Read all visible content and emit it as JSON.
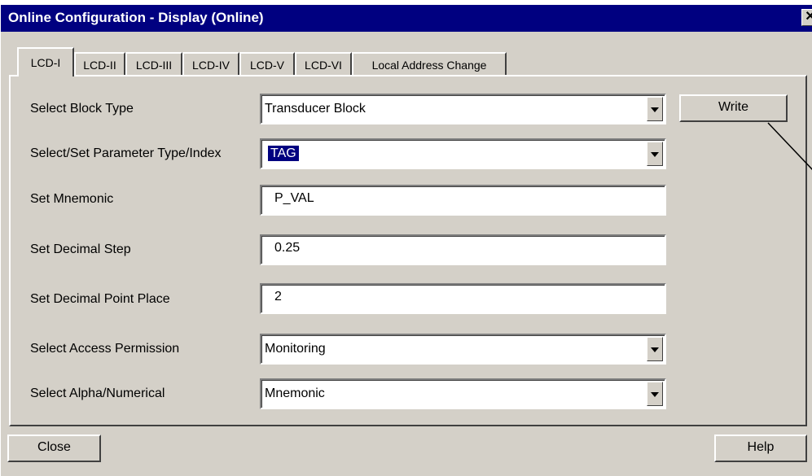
{
  "window": {
    "title": "Online Configuration - Display  (Online)",
    "close_glyph": "✕"
  },
  "tabs": [
    {
      "label": "LCD-I",
      "active": true
    },
    {
      "label": "LCD-II",
      "active": false
    },
    {
      "label": "LCD-III",
      "active": false
    },
    {
      "label": "LCD-IV",
      "active": false
    },
    {
      "label": "LCD-V",
      "active": false
    },
    {
      "label": "LCD-VI",
      "active": false
    },
    {
      "label": "Local Address Change",
      "active": false
    }
  ],
  "form": {
    "block_type": {
      "label": "Select Block Type",
      "value": "Transducer Block"
    },
    "parameter": {
      "label": "Select/Set Parameter Type/Index",
      "value": "TAG"
    },
    "mnemonic": {
      "label": "Set Mnemonic",
      "value": "P_VAL"
    },
    "decimal_step": {
      "label": "Set Decimal Step",
      "value": "0.25"
    },
    "decimal_place": {
      "label": "Set Decimal Point Place",
      "value": "2"
    },
    "access": {
      "label": "Select Access Permission",
      "value": "Monitoring"
    },
    "alpha": {
      "label": "Select Alpha/Numerical",
      "value": "Mnemonic"
    }
  },
  "buttons": {
    "write": "Write",
    "close": "Close",
    "help": "Help"
  },
  "colors": {
    "titlebar": "#000080",
    "face": "#d4d0c8",
    "selection": "#000080"
  },
  "icons": [
    "close-icon",
    "dropdown-arrow-icon"
  ]
}
